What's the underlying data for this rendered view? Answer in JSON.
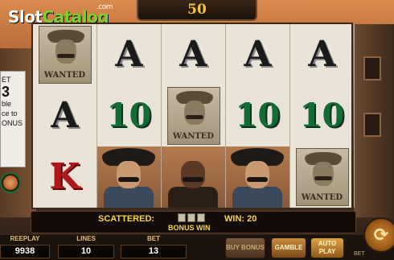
{
  "brand": {
    "logo_slot": "Slot",
    "logo_catalog": "Catalog",
    "logo_com": ".com"
  },
  "header": {
    "lines_value": "50"
  },
  "side_panel": {
    "bet_lines": [
      "ET",
      "3",
      "ble",
      "ce to",
      "ONUS"
    ]
  },
  "reels": [
    [
      {
        "type": "wanted",
        "label": "WANTED"
      },
      {
        "type": "card",
        "symbol": "A"
      },
      {
        "type": "card",
        "symbol": "K"
      }
    ],
    [
      {
        "type": "card",
        "symbol": "A"
      },
      {
        "type": "card",
        "symbol": "10"
      },
      {
        "type": "outlaw",
        "variant": "hat"
      }
    ],
    [
      {
        "type": "card",
        "symbol": "A"
      },
      {
        "type": "wanted",
        "label": "WANTED"
      },
      {
        "type": "outlaw",
        "variant": "dark"
      }
    ],
    [
      {
        "type": "card",
        "symbol": "A"
      },
      {
        "type": "card",
        "symbol": "10"
      },
      {
        "type": "outlaw",
        "variant": "hat"
      }
    ],
    [
      {
        "type": "card",
        "symbol": "A"
      },
      {
        "type": "card",
        "symbol": "10"
      },
      {
        "type": "wanted",
        "label": "WANTED"
      }
    ]
  ],
  "status": {
    "scattered_label": "SCATTERED:",
    "win_label": "WIN: 20",
    "bonus_label": "BONUS WIN"
  },
  "meters": {
    "freeplay_label": "REEPLAY",
    "freeplay_value": "9938",
    "lines_label": "LINES",
    "lines_value": "10",
    "bet_label": "BET",
    "bet_value": "13"
  },
  "buttons": {
    "buy_bonus": "BUY BONUS",
    "gamble": "GAMBLE",
    "autoplay": "AUTO PLAY",
    "spin_icon": "refresh-arrow-icon",
    "side_bet": "BET"
  },
  "colors": {
    "accent": "#f4d44a",
    "card_green": "#126a34",
    "card_red": "#b01818"
  }
}
